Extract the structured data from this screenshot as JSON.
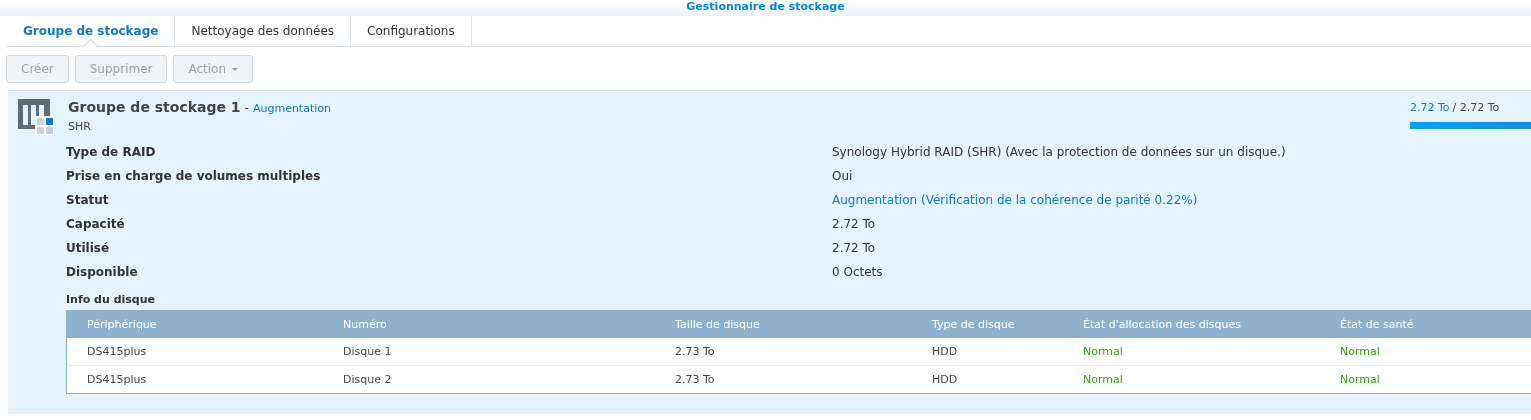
{
  "window": {
    "title": "Gestionnaire de stockage"
  },
  "tabs": [
    {
      "label": "Groupe de stockage",
      "selected": true
    },
    {
      "label": "Nettoyage des données",
      "selected": false
    },
    {
      "label": "Configurations",
      "selected": false
    }
  ],
  "toolbar": [
    {
      "label": "Créer",
      "disabled": true,
      "dropdown": false
    },
    {
      "label": "Supprimer",
      "disabled": true,
      "dropdown": false
    },
    {
      "label": "Action",
      "disabled": true,
      "dropdown": true
    }
  ],
  "pool": {
    "title": "Groupe de stockage 1",
    "separator": "-",
    "status": "Augmentation",
    "subtitle": "SHR",
    "usage_used": "2.72 To",
    "usage_total": "/ 2.72 To",
    "level": 1,
    "properties": [
      {
        "label": "Type de RAID",
        "value": "Synology Hybrid RAID (SHR) (Avec la protection de données sur un disque.)",
        "kind": "plain"
      },
      {
        "label": "Prise en charge de volumes multiples",
        "value": "Oui",
        "kind": "plain"
      },
      {
        "label": "Statut",
        "value": "Augmentation (Vérification de la cohérence de parité 0.22%)",
        "kind": "link"
      },
      {
        "label": "Capacité",
        "value": "2.72 To",
        "kind": "plain"
      },
      {
        "label": "Utilisé",
        "value": "2.72 To",
        "kind": "plain"
      },
      {
        "label": "Disponible",
        "value": "0 Octets",
        "kind": "plain"
      }
    ],
    "disk_info": {
      "title": "Info du disque",
      "columns": [
        {
          "label": "Périphérique",
          "kind": "plain"
        },
        {
          "label": "Numéro",
          "kind": "plain"
        },
        {
          "label": "Taille de disque",
          "kind": "plain"
        },
        {
          "label": "Type de disque",
          "kind": "plain"
        },
        {
          "label": "État d'allocation des disques",
          "kind": "status"
        },
        {
          "label": "État de santé",
          "kind": "status"
        }
      ],
      "rows": [
        [
          "DS415plus",
          "Disque 1",
          "2.73 To",
          "HDD",
          "Normal",
          "Normal"
        ],
        [
          "DS415plus",
          "Disque 2",
          "2.73 To",
          "HDD",
          "Normal",
          "Normal"
        ]
      ]
    }
  }
}
